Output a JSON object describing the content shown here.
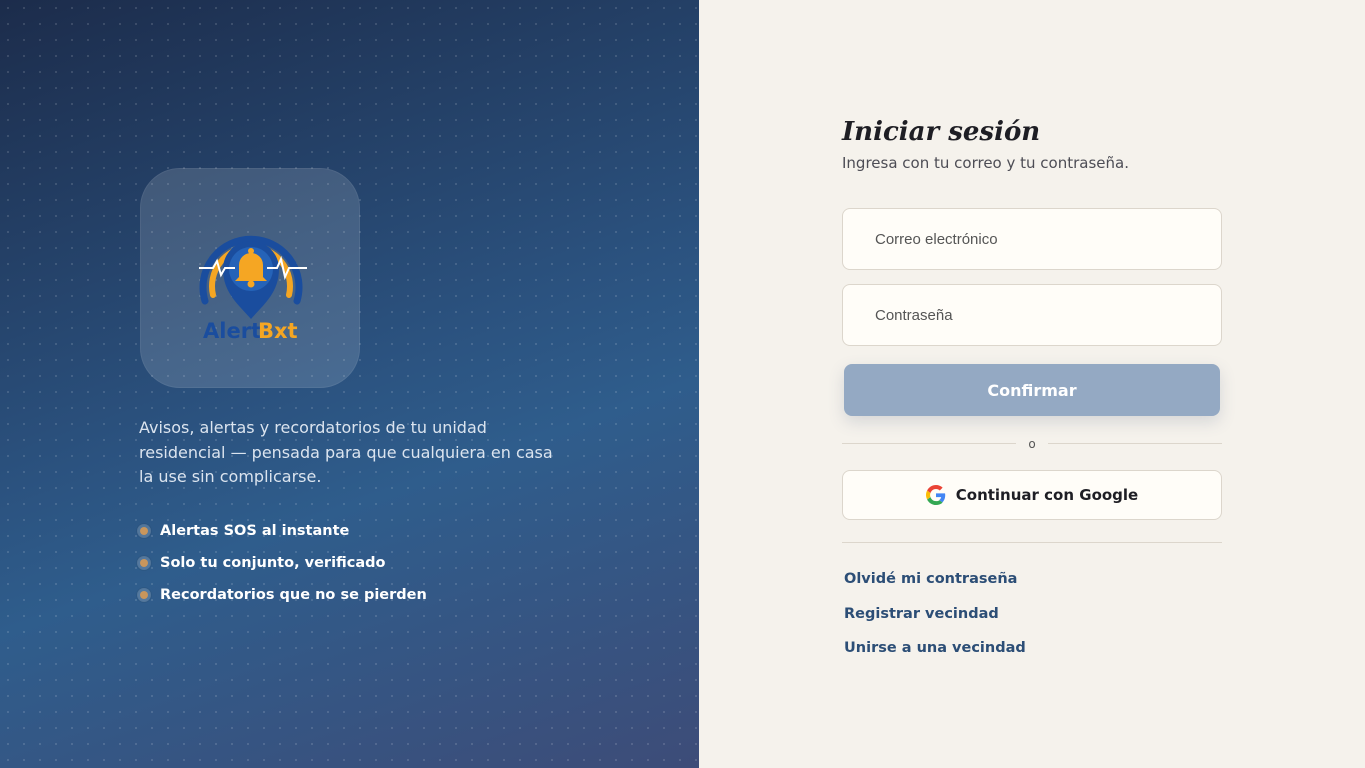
{
  "brand": {
    "logo_text_a": "Alert",
    "logo_text_b": "Bxt",
    "logo_icon": "bell-location-pin-icon",
    "colors": {
      "navy": "#1a4d9e",
      "orange": "#f5a623"
    }
  },
  "hero": {
    "tagline": "Avisos, alertas y recordatorios de tu unidad residencial — pensada para que cualquiera en casa la use sin complicarse.",
    "features": [
      "Alertas SOS al instante",
      "Solo tu conjunto, verificado",
      "Recordatorios que no se pierden"
    ]
  },
  "login": {
    "title": "Iniciar sesión",
    "subtitle": "Ingresa con tu correo y tu contraseña.",
    "email_placeholder": "Correo electrónico",
    "password_placeholder": "Contraseña",
    "confirm_label": "Confirmar",
    "divider_text": "o",
    "google_label": "Continuar con Google",
    "links": {
      "forgot": "Olvidé mi contraseña",
      "register": "Registrar vecindad",
      "join": "Unirse a una vecindad"
    }
  },
  "colors": {
    "panel_bg": "#f5f2ec",
    "link": "#2c4e76",
    "button_disabled": "#94a9c3",
    "bullet": "#c9965c"
  }
}
